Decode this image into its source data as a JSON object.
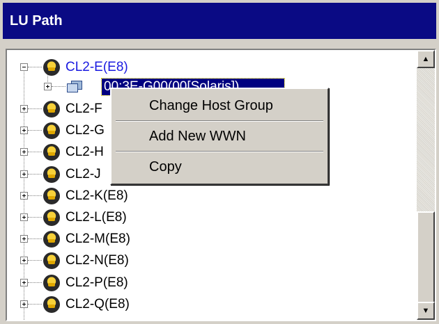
{
  "title": "LU Path",
  "tree": {
    "expanded_port": "CL2-E(E8)",
    "host_group": "00:3E-G00(00[Solaris])",
    "ports": [
      "CL2-F",
      "CL2-G",
      "CL2-H",
      "CL2-J",
      "CL2-K(E8)",
      "CL2-L(E8)",
      "CL2-M(E8)",
      "CL2-N(E8)",
      "CL2-P(E8)",
      "CL2-Q(E8)"
    ]
  },
  "context_menu": {
    "items": [
      "Change Host Group",
      "Add New WWN",
      "Copy"
    ]
  },
  "scrollbar": {
    "up_arrow": "▲",
    "down_arrow": "▼"
  },
  "icons": {
    "port": "fibre-port-icon",
    "host": "host-group-icon"
  },
  "colors": {
    "titlebar": "#0a0a84",
    "selection": "#000080",
    "expanded_label": "#1a1ae0"
  }
}
